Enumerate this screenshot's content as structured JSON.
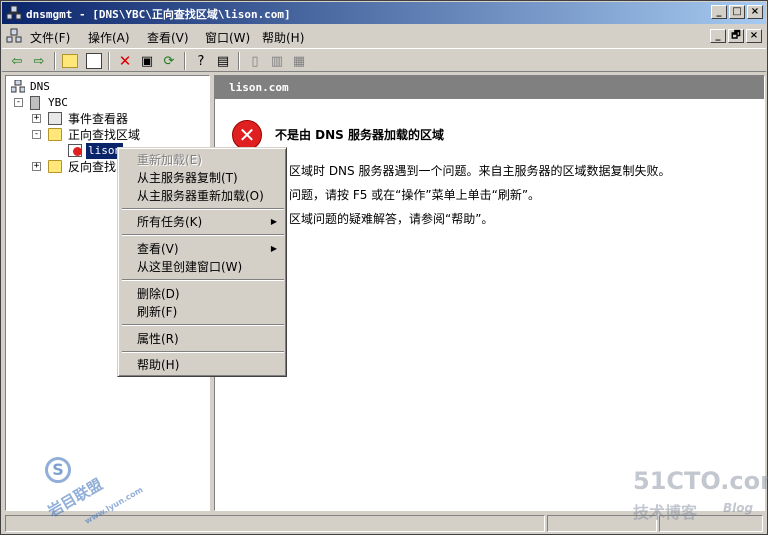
{
  "window": {
    "title": "dnsmgmt - [DNS\\YBC\\正向查找区域\\lison.com]",
    "caption_buttons": [
      "_",
      "□",
      "×"
    ],
    "child_buttons": [
      "_",
      "🗗",
      "×"
    ]
  },
  "menu": {
    "items": [
      "文件(F)",
      "操作(A)",
      "查看(V)",
      "窗口(W)",
      "帮助(H)"
    ]
  },
  "toolbar": {
    "buttons": [
      "back",
      "forward",
      "up",
      "show-hide-tree",
      "delete",
      "properties",
      "refresh",
      "help",
      "export",
      "server",
      "zone",
      "record"
    ]
  },
  "tree": {
    "root": "DNS",
    "server": "YBC",
    "event_viewer": "事件查看器",
    "forward_zones": "正向查找区域",
    "selected_zone": "lison",
    "reverse_zones": "反向查找"
  },
  "details": {
    "header": "lison.com",
    "error_title": "不是由 DNS 服务器加载的区域",
    "line1": "区域时 DNS 服务器遇到一个问题。来自主服务器的区域数据复制失败。",
    "line2": "问题，请按 F5 或在“操作”菜单上单击“刷新”。",
    "line3": "区域问题的疑难解答，请参阅“帮助”。"
  },
  "context_menu": {
    "reload": "重新加载(E)",
    "transfer": "从主服务器复制(T)",
    "reload_from_master": "从主服务器重新加载(O)",
    "all_tasks": "所有任务(K)",
    "view": "查看(V)",
    "new_window": "从这里创建窗口(W)",
    "delete": "删除(D)",
    "refresh": "刷新(F)",
    "properties": "属性(R)",
    "help": "帮助(H)"
  },
  "watermarks": {
    "site": "51CTO.com",
    "sub": "技术博客",
    "blog": "Blog",
    "left": "岩目联盟",
    "left_url": "www.lyun.com"
  },
  "colors": {
    "title_start": "#0a246a",
    "title_end": "#a6caf0",
    "header_gray": "#808080",
    "error_red": "#e02020",
    "selection": "#0a246a"
  }
}
